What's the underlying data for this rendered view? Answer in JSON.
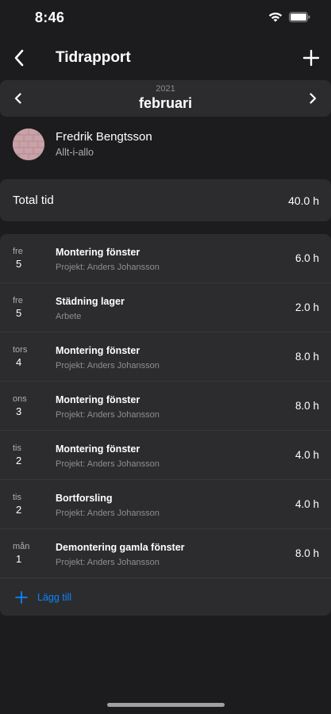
{
  "status_bar": {
    "time": "8:46"
  },
  "nav": {
    "title": "Tidrapport"
  },
  "month_picker": {
    "year": "2021",
    "month": "februari"
  },
  "profile": {
    "name": "Fredrik Bengtsson",
    "company": "Allt-i-allo"
  },
  "total": {
    "label": "Total tid",
    "value": "40.0 h"
  },
  "entries": [
    {
      "day_name": "fre",
      "day_num": "5",
      "title": "Montering fönster",
      "subtitle": "Projekt: Anders Johansson",
      "hours": "6.0 h"
    },
    {
      "day_name": "fre",
      "day_num": "5",
      "title": "Städning lager",
      "subtitle": "Arbete",
      "hours": "2.0 h"
    },
    {
      "day_name": "tors",
      "day_num": "4",
      "title": "Montering fönster",
      "subtitle": "Projekt: Anders Johansson",
      "hours": "8.0 h"
    },
    {
      "day_name": "ons",
      "day_num": "3",
      "title": "Montering fönster",
      "subtitle": "Projekt: Anders Johansson",
      "hours": "8.0 h"
    },
    {
      "day_name": "tis",
      "day_num": "2",
      "title": "Montering fönster",
      "subtitle": "Projekt: Anders Johansson",
      "hours": "4.0 h"
    },
    {
      "day_name": "tis",
      "day_num": "2",
      "title": "Bortforsling",
      "subtitle": "Projekt: Anders Johansson",
      "hours": "4.0 h"
    },
    {
      "day_name": "mån",
      "day_num": "1",
      "title": "Demontering gamla fönster",
      "subtitle": "Projekt: Anders Johansson",
      "hours": "8.0 h"
    }
  ],
  "add": {
    "label": "Lägg till"
  },
  "icons": {
    "back": "chevron-left-icon",
    "add": "plus-icon",
    "prev_month": "chevron-left-icon",
    "next_month": "chevron-right-icon",
    "add_entry": "plus-icon",
    "wifi": "wifi-icon",
    "battery": "battery-icon"
  },
  "colors": {
    "background": "#1c1c1e",
    "card": "#2c2c2e",
    "accent": "#0a84ff",
    "secondary_text": "#8e8e93"
  }
}
